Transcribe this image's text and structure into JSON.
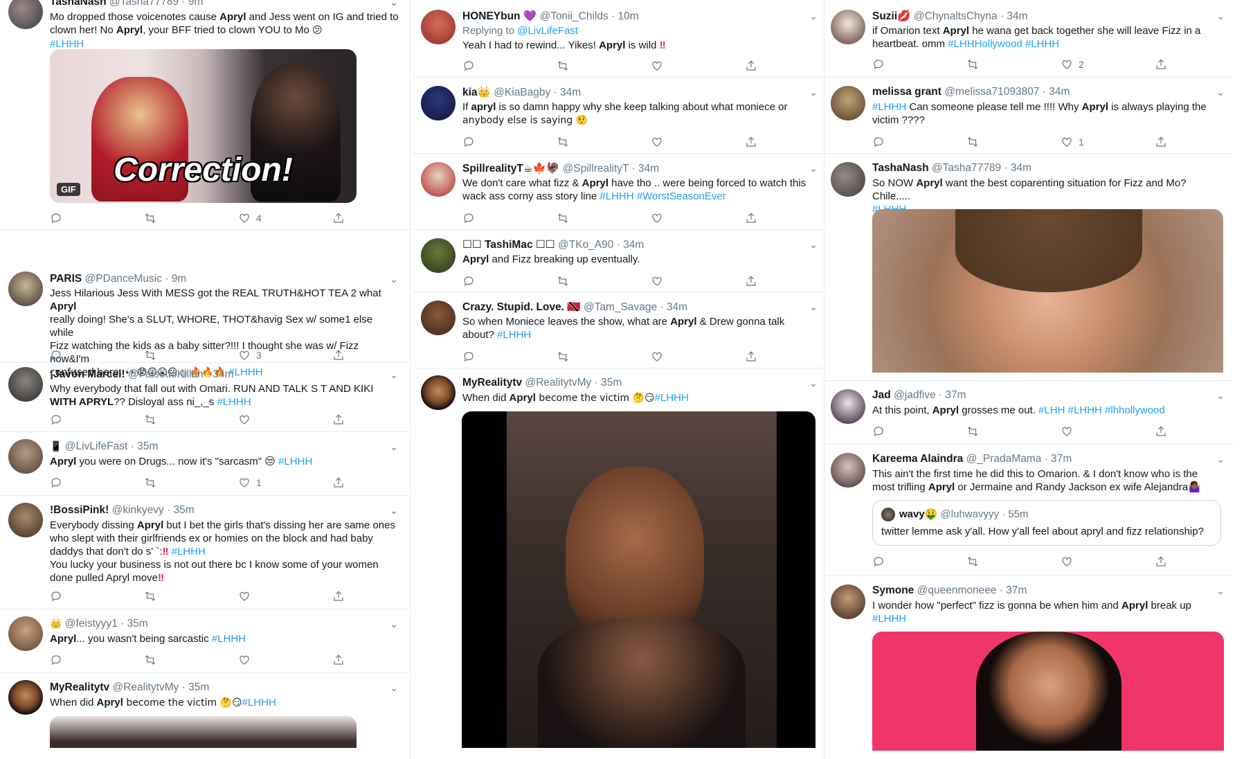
{
  "icons": {
    "reply": "reply-icon",
    "retweet": "retweet-icon",
    "like": "heart-icon",
    "share": "share-icon",
    "caret": "chevron-down-icon"
  },
  "colors": {
    "link": "#1da1f2",
    "muted": "#657786",
    "heart_emoji": "#e0245e",
    "border": "#e6ecf0"
  },
  "col1": {
    "t1": {
      "name": "TashaNash",
      "handle": "@Tasha77789",
      "time": "9m",
      "text_parts": [
        "Mo dropped those voicenotes cause ",
        "Apryl",
        " and Jess went on IG and tried to clown her! No ",
        "Apryl",
        ", your BFF tried to clown YOU to Mo ",
        "😕"
      ],
      "hashtag": "#LHHH",
      "media_caption": "Correction!",
      "gif_label": "GIF",
      "likes": "4"
    },
    "t2": {
      "name": "PARIS",
      "handle": "@PDanceMusic",
      "time": "9m",
      "line1": "Jess Hilarious Jess With MESS got the REAL TRUTH&HOT TEA 2 what ",
      "line1_bold": "Apryl",
      "line2": " really doing! She's a SLUT, WHORE, THOT&havig Sex w/ some1 else while",
      "line3": "Fizz watching the kids as a baby sitter?!!! I thought she was w/ Fizz now&I'm",
      "line4": "confused here. 👀😰😲😲😐🍵🔥🔥🔥",
      "hashtag": "#LHHH",
      "likes": "3"
    },
    "t3": {
      "name": "¡Javón Marcel!",
      "handle": "@FalsettoKillah",
      "time": "34m",
      "line1": "Why everybody that fall out with Omari. RUN AND TALK S    T AND KIKI",
      "line2_bold": "WITH APRYL",
      "line2": "?? Disloyal ass ni_,_s ",
      "hashtag": "#LHHH"
    },
    "t4": {
      "name": "📱",
      "handle": "@LivLifeFast",
      "time": "35m",
      "bold": "Apryl",
      "text": " you were on Drugs... now it's \"sarcasm\" 😒 ",
      "hashtag": "#LHHH",
      "likes": "1"
    },
    "t5": {
      "name": "!BossiPink!",
      "handle": "@kinkyevy",
      "time": "35m",
      "line1a": "Everybody dissing ",
      "line1b": "Apryl",
      "line1c": " but I bet the girls that's dissing her are same ones",
      "line2": "who slept with their girlfriends ex or homies on the block and had baby",
      "line3": "daddys that don't do s'  `:",
      "line3_red": "‼",
      "hashtag": "#LHHH",
      "line4": " You lucky your business is not out there bc I know some of your women",
      "line5": "done pulled Apryl move",
      "line5_red": "‼"
    },
    "t6": {
      "name": "👑",
      "handle": "@feistyyy1",
      "time": "35m",
      "bold": "Apryl",
      "text": "... you wasn't being sarcastic ",
      "hashtag": "#LHHH"
    },
    "t7": {
      "name": "MyRealitytv",
      "handle": "@RealitytvMy",
      "time": "35m",
      "text_a": "When did ",
      "bold": "Apryl",
      "text_b": " become the victim 🤔😏",
      "hashtag": "#LHHH"
    }
  },
  "col2": {
    "t1": {
      "name": "HONEYbun 💜",
      "handle": "@Tonii_Childs",
      "time": "10m",
      "replying": "Replying to ",
      "replying_to": "@LivLifeFast",
      "text_a": "Yeah I had to rewind... Yikes! ",
      "bold": "Apryl",
      "text_b": " is wild ",
      "red": "‼"
    },
    "t2": {
      "name": "kia👑",
      "handle": "@KiaBagby",
      "time": "34m",
      "line1a": "If ",
      "line1b": "apryl",
      "line1c": " is so damn happy why she keep talking about what moniece or",
      "line2": "anybody else is saying 🤨"
    },
    "t3": {
      "name": "SpillrealityT☕🍁🦃",
      "handle": "@SpillrealityT",
      "time": "34m",
      "line1a": "We don't care what fizz & ",
      "line1b": "Apryl",
      "line1c": " have tho .. were being forced to watch this",
      "line2": "wack ass corny ass story line ",
      "hashtag1": "#LHHH",
      "hashtag2": "#WorstSeasonEver"
    },
    "t4": {
      "name": "☐☐ TashiMac ☐☐",
      "handle": "@TKo_A90",
      "time": "34m",
      "bold": "Apryl",
      "text": " and Fizz breaking up eventually."
    },
    "t5": {
      "name": "Crazy. Stupid. Love. 🇹🇹",
      "handle": "@Tam_Savage",
      "time": "34m",
      "line1a": "So when Moniece leaves the show, what are ",
      "line1b": "Apryl",
      "line1c": " & Drew gonna talk",
      "line2": "about? ",
      "hashtag": "#LHHH"
    },
    "t6": {
      "name": "MyRealitytv",
      "handle": "@RealitytvMy",
      "time": "35m",
      "text_a": "When did ",
      "bold": "Apryl",
      "text_b": " become the victim 🤔😏",
      "hashtag": "#LHHH"
    }
  },
  "col3": {
    "t1": {
      "name": "Suzii💋",
      "handle": "@ChynaltsChyna",
      "time": "34m",
      "line1a": "if Omarion text ",
      "line1b": "Apryl",
      "line1c": " he wana get back together she will leave Fizz in a",
      "line2": "heartbeat. omm ",
      "hashtag1": "#LHHHollywood",
      "hashtag2": "#LHHH",
      "likes": "2"
    },
    "t2": {
      "name": "melissa grant",
      "handle": "@melissa71093807",
      "time": "34m",
      "hashtag": "#LHHH",
      "line1": " Can someone please tell me !!!! Why ",
      "line1b": "Apryl",
      "line1c": " is always playing the",
      "line2": "victim ????",
      "likes": "1"
    },
    "t3": {
      "name": "TashaNash",
      "handle": "@Tasha77789",
      "time": "34m",
      "line1a": "So NOW ",
      "line1b": "Apryl",
      "line1c": " want the best coparenting situation for Fizz and Mo? Chile.....",
      "hashtag": "#LHHH"
    },
    "t4": {
      "name": "Jad",
      "handle": "@jadfive",
      "time": "37m",
      "text_a": "At this point, ",
      "bold": "Apryl",
      "text_b": " grosses me out. ",
      "hashtag1": "#LHH",
      "hashtag2": "#LHHH",
      "hashtag3": "#lhhollywood"
    },
    "t5": {
      "name": "Kareema Alaindra",
      "handle": "@_PradaMama",
      "time": "37m",
      "line1": "This ain't the first time he did this to Omarion. & I don't know who is the",
      "line2a": "most trifling ",
      "line2b": "Apryl",
      "line2c": " or Jermaine and Randy Jackson ex wife Alejandra🤷🏾‍♀️",
      "quote_name": "wavy🤑",
      "quote_handle": "@luhwavyyy",
      "quote_time": "55m",
      "quote_text": "twitter lemme ask y'all. How y'all feel about apryl and fizz relationship?"
    },
    "t6": {
      "name": "Symone",
      "handle": "@queenmoneee",
      "time": "37m",
      "line1a": "I wonder how \"perfect\" fizz is gonna be when him and ",
      "line1b": "Apryl",
      "line1c": " break up",
      "hashtag": "#LHHH"
    }
  }
}
